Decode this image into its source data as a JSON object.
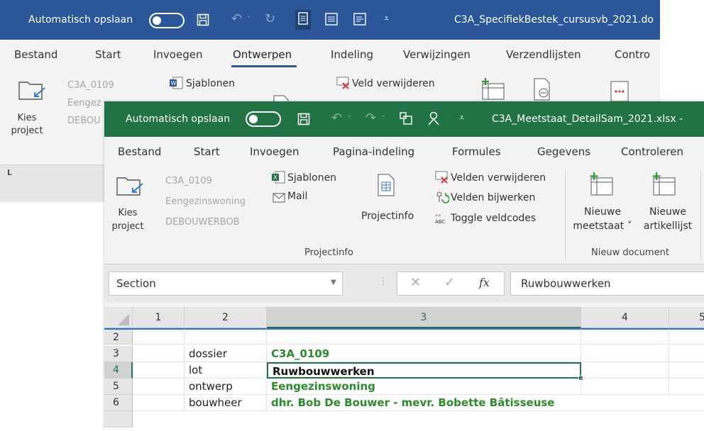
{
  "word": {
    "autosave_label": "Automatisch opslaan",
    "file_title": "C3A_SpecifiekBestek_cursusvb_2021.do",
    "tabs": [
      "Bestand",
      "Start",
      "Invoegen",
      "Ontwerpen",
      "Indeling",
      "Verwijzingen",
      "Verzendlijsten",
      "Contro"
    ],
    "active_tab": "Ontwerpen",
    "kies_project": [
      "Kies",
      "project"
    ],
    "project_lines": [
      "C3A_0109",
      "Eengez",
      "DEBOU"
    ],
    "sjablonen": "Sjablonen",
    "veld_verwijderen": "Veld verwijderen",
    "ruler_mark": "L"
  },
  "excel": {
    "autosave_label": "Automatisch opslaan",
    "file_title": "C3A_Meetstaat_DetailSam_2021.xlsx -",
    "tabs": [
      "Bestand",
      "Start",
      "Invoegen",
      "Pagina-indeling",
      "Formules",
      "Gegevens",
      "Controleren"
    ],
    "kies_project": [
      "Kies",
      "project"
    ],
    "project_lines": [
      "C3A_0109",
      "Eengezinswoning",
      "DEBOUWERBOB"
    ],
    "sjablonen": "Sjablonen",
    "mail": "Mail",
    "projectinfo_button": "Projectinfo",
    "velden_verwijderen": "Velden verwijderen",
    "velden_bijwerken": "Velden bijwerken",
    "toggle_veldcodes": "Toggle veldcodes",
    "nieuwe_meetstaat": [
      "Nieuwe",
      "meetstaat ˅"
    ],
    "nieuwe_artikellijst": [
      "Nieuwe",
      "artikellijst"
    ],
    "group_projectinfo": "Projectinfo",
    "group_nieuw_document": "Nieuw document",
    "name_box": "Section",
    "formula_value": "Ruwbouwwerken",
    "fx": "fx",
    "columns": [
      "1",
      "2",
      "3",
      "4",
      "5"
    ],
    "rows": [
      {
        "num": "2",
        "label": "",
        "value": ""
      },
      {
        "num": "3",
        "label": "dossier",
        "value": "C3A_0109"
      },
      {
        "num": "4",
        "label": "lot",
        "value": "Ruwbouwwerken"
      },
      {
        "num": "5",
        "label": "ontwerp",
        "value": "Eengezinswoning"
      },
      {
        "num": "6",
        "label": "bouwheer",
        "value": "dhr. Bob De Bouwer - mevr. Bobette Bâtisseuse"
      }
    ]
  },
  "colors": {
    "word_blue": "#2b579a",
    "excel_green": "#217346",
    "cell_green": "#2a8b2a"
  }
}
